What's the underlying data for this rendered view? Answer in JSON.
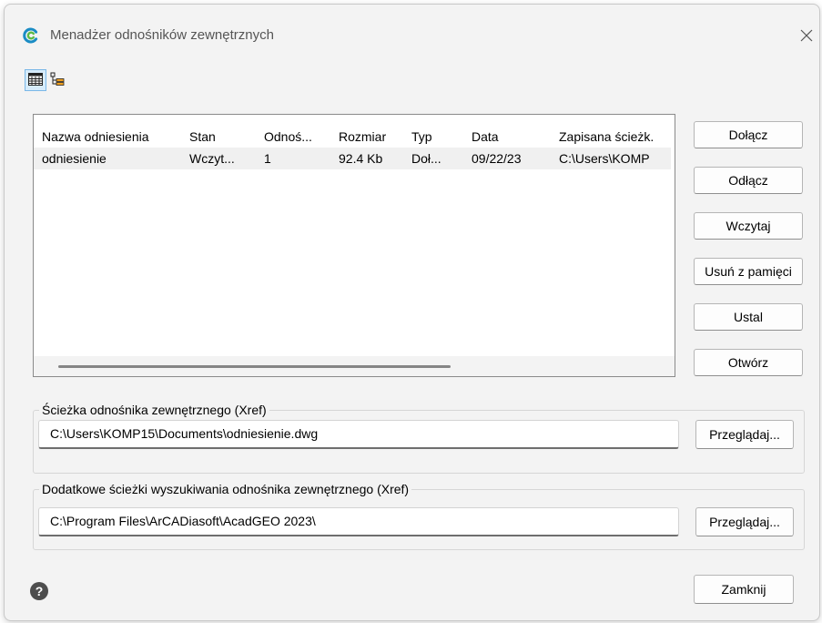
{
  "window": {
    "title": "Menadżer odnośników zewnętrznych",
    "app_icon": "app-logo-icon",
    "close_icon": "close-icon"
  },
  "toolbar": {
    "list_view_icon": "list-view-icon",
    "tree_view_icon": "tree-view-icon"
  },
  "table": {
    "columns": [
      "Nazwa odniesienia",
      "Stan",
      "Odnoś...",
      "Rozmiar",
      "Typ",
      "Data",
      "Zapisana ścieżk."
    ],
    "rows": [
      [
        "odniesienie",
        "Wczyt...",
        "1",
        "92.4 Kb",
        "Doł...",
        "09/22/23",
        "C:\\Users\\KOMP"
      ]
    ]
  },
  "side_buttons": {
    "attach": "Dołącz",
    "detach": "Odłącz",
    "reload": "Wczytaj",
    "unload": "Usuń z pamięci",
    "bind": "Ustal",
    "open": "Otwórz"
  },
  "xref_path": {
    "legend": "Ścieżka odnośnika zewnętrznego (Xref)",
    "value": "C:\\Users\\KOMP15\\Documents\\odniesienie.dwg",
    "browse": "Przeglądaj..."
  },
  "search_paths": {
    "legend": "Dodatkowe ścieżki wyszukiwania odnośnika zewnętrznego (Xref)",
    "value": "C:\\Program Files\\ArCADiasoft\\AcadGEO 2023\\",
    "browse": "Przeglądaj..."
  },
  "footer": {
    "help_icon": "help-icon",
    "close_button": "Zamknij"
  },
  "colors": {
    "window_bg": "#f3f3f3",
    "accent": "#1a8cc4",
    "selected_row": "#f0f0f0"
  }
}
